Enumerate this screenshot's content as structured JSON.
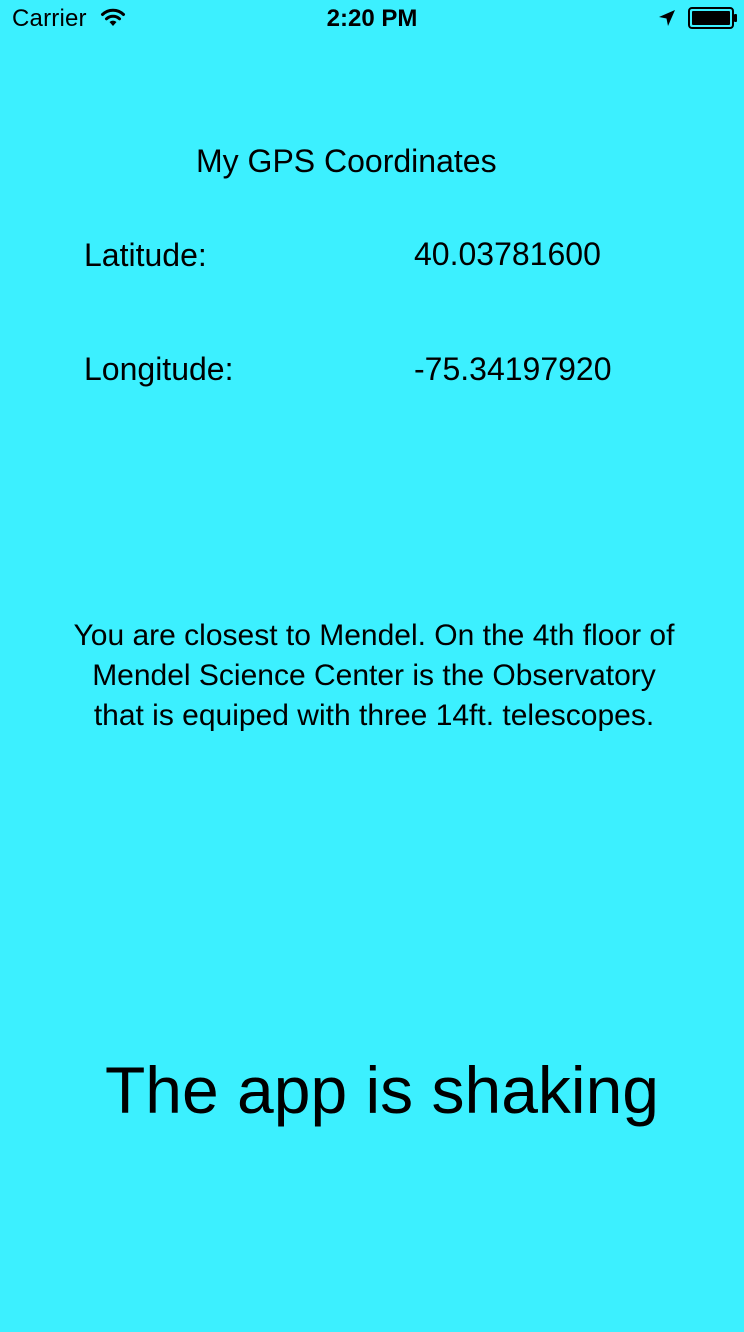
{
  "status_bar": {
    "carrier": "Carrier",
    "time": "2:20 PM",
    "icons": [
      "wifi-icon",
      "location-arrow-icon",
      "battery-icon"
    ]
  },
  "screen": {
    "background_color": "#3CF0FF",
    "title": "My GPS Coordinates",
    "latitude_label": "Latitude:",
    "latitude_value": "40.03781600",
    "longitude_label": "Longitude:",
    "longitude_value": "-75.34197920",
    "message": "You are closest to Mendel. On the 4th floor of Mendel Science Center is the Observatory that is equiped with three 14ft. telescopes.",
    "shake_status": "The app is shaking"
  }
}
